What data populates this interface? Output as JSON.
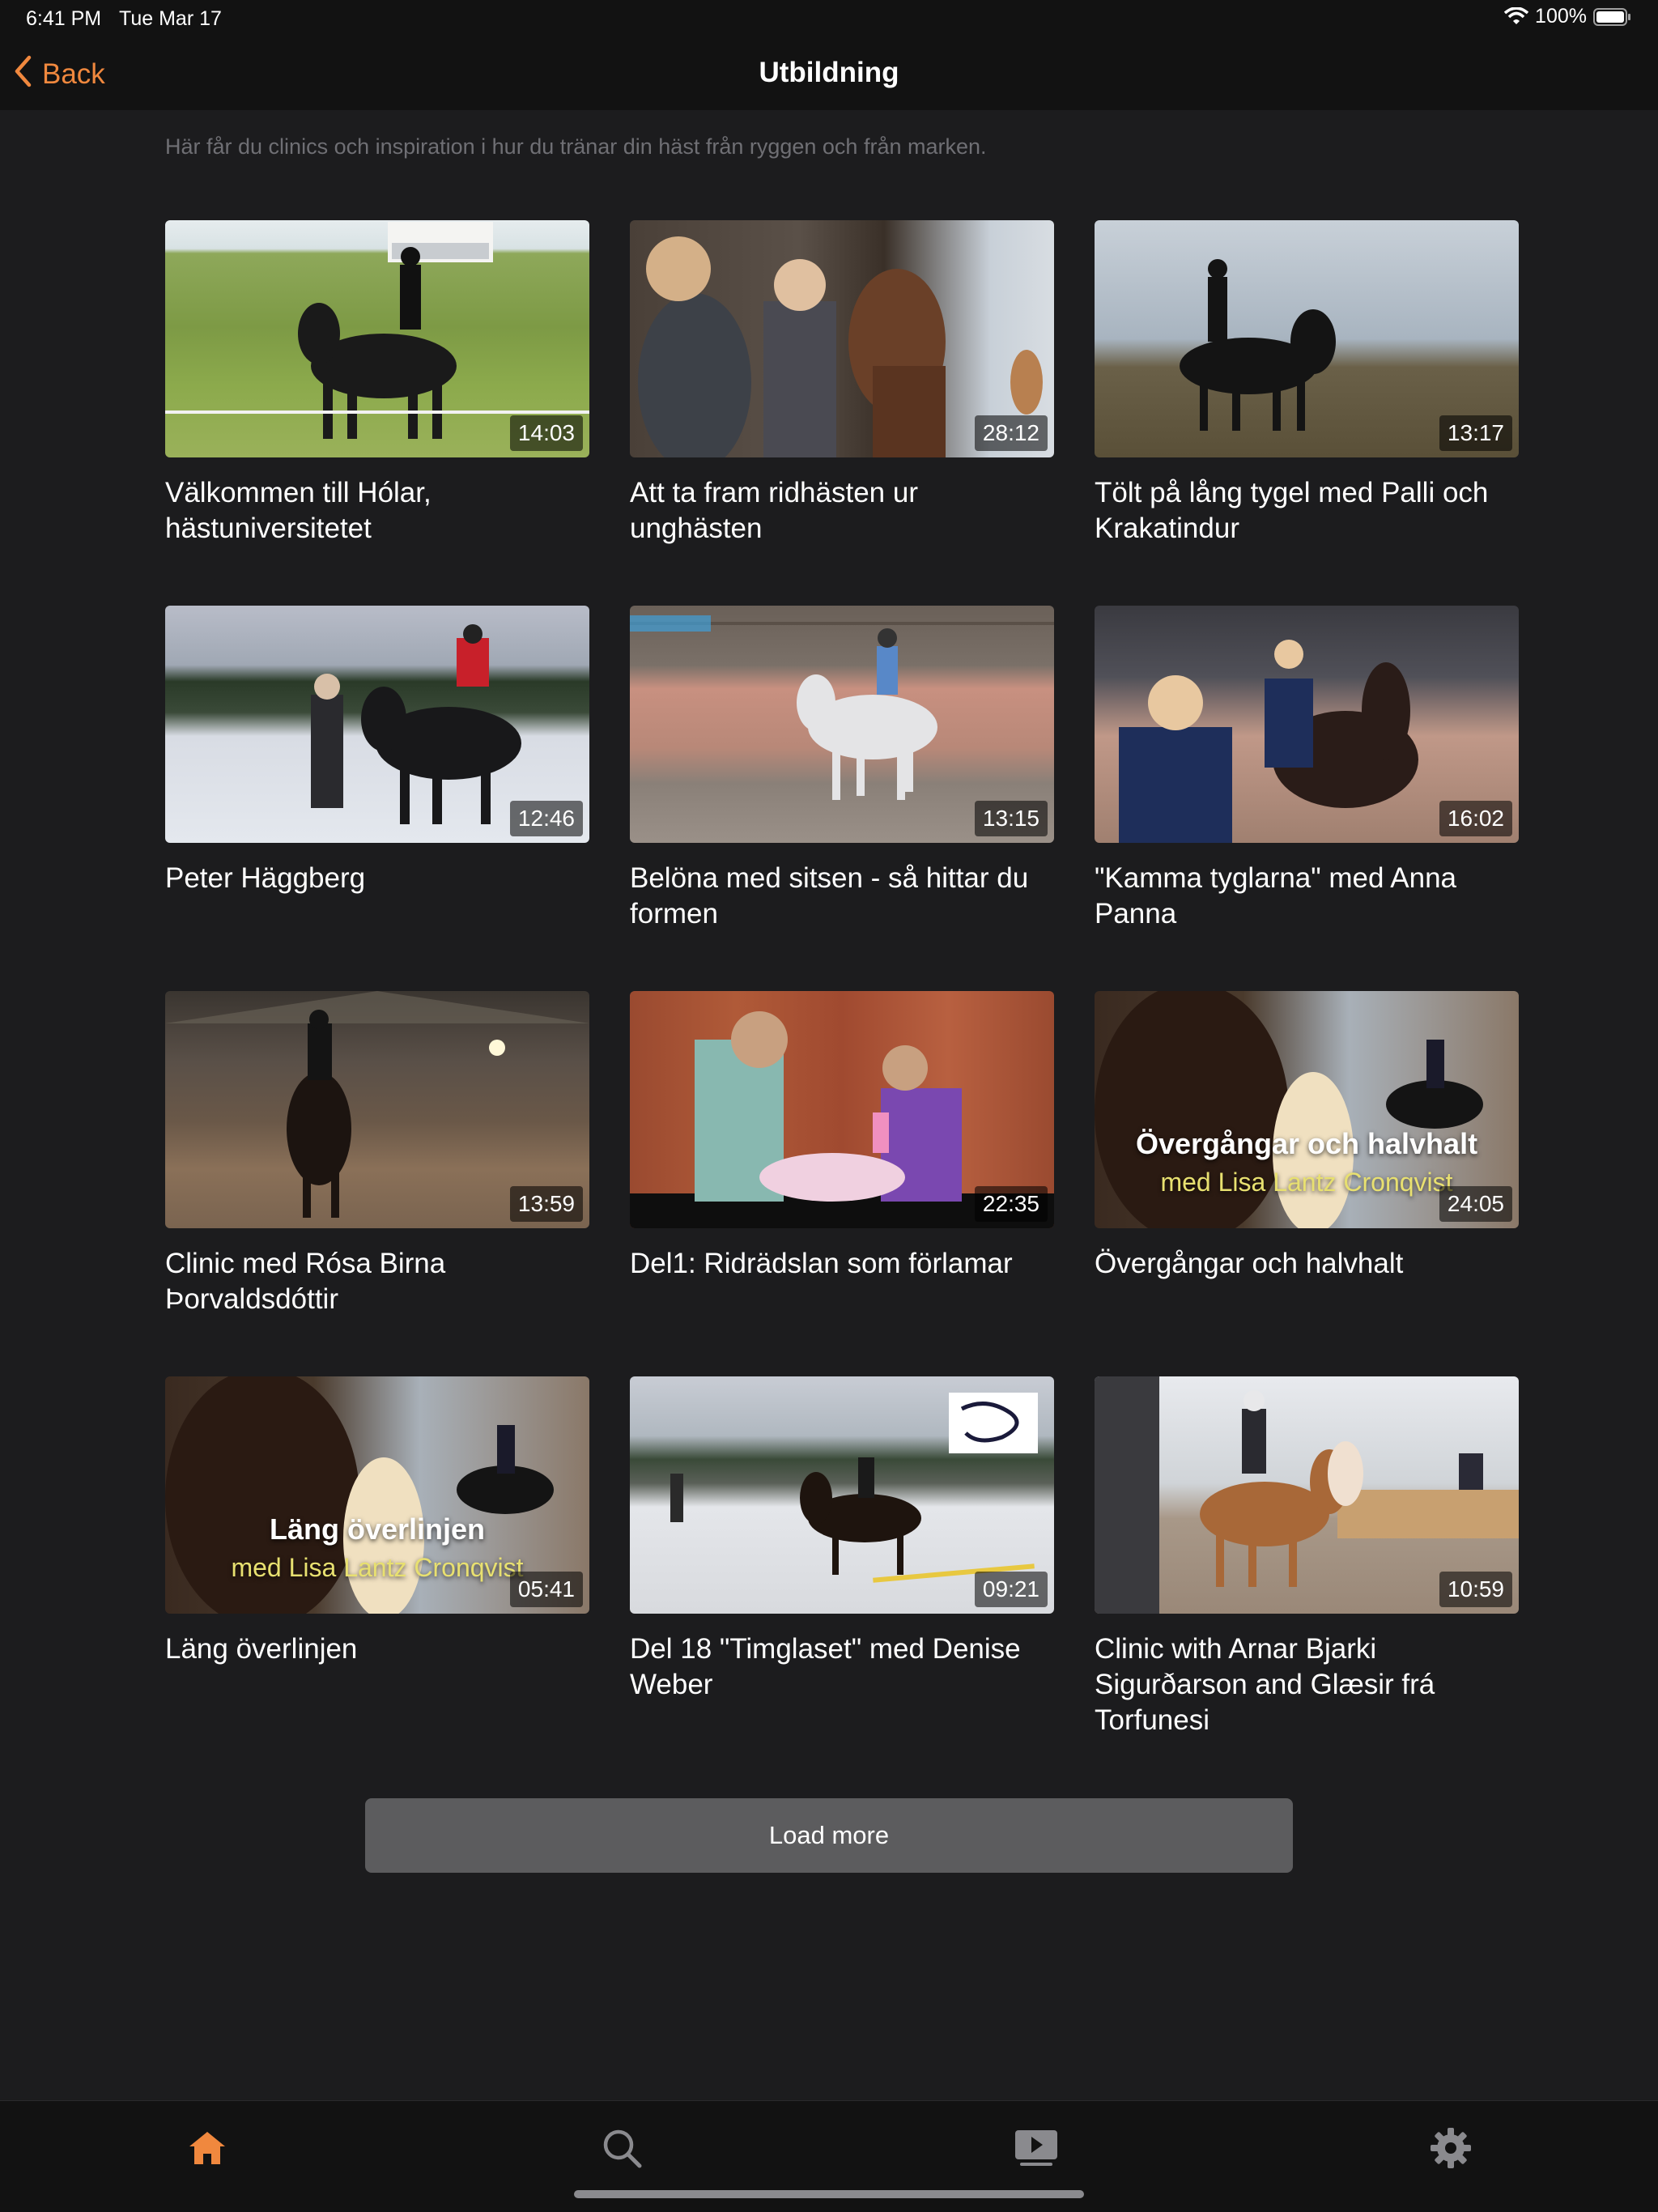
{
  "status": {
    "time": "6:41 PM",
    "date": "Tue Mar 17",
    "battery": "100%"
  },
  "nav": {
    "back_label": "Back",
    "title": "Utbildning"
  },
  "description": "Här får du clinics och inspiration i hur du tränar din häst från ryggen och från marken.",
  "videos": [
    {
      "title": "Välkommen till Hólar, hästuniversitetet",
      "duration": "14:03"
    },
    {
      "title": "Att ta fram ridhästen ur unghästen",
      "duration": "28:12"
    },
    {
      "title": "Tölt på lång tygel med Palli och Krakatindur",
      "duration": "13:17"
    },
    {
      "title": "Peter Häggberg",
      "duration": "12:46"
    },
    {
      "title": "Belöna med sitsen - så hittar du formen",
      "duration": "13:15"
    },
    {
      "title": "\"Kamma tyglarna\" med Anna Panna",
      "duration": "16:02"
    },
    {
      "title": "Clinic med Rósa Birna Þorvaldsdóttir",
      "duration": "13:59"
    },
    {
      "title": "Del1: Ridrädslan som förlamar",
      "duration": "22:35"
    },
    {
      "title": "Övergångar och halvhalt",
      "duration": "24:05",
      "overlay": "Övergångar och halvhalt",
      "overlay_sub": "med Lisa Lantz Cronqvist"
    },
    {
      "title": "Läng överlinjen",
      "duration": "05:41",
      "overlay": "Läng överlinjen",
      "overlay_sub": "med Lisa Lantz Cronqvist"
    },
    {
      "title": "Del 18 \"Timglaset\" med Denise Weber",
      "duration": "09:21"
    },
    {
      "title": "Clinic with Arnar Bjarki Sigurðarson and Glæsir frá Torfunesi",
      "duration": "10:59"
    }
  ],
  "load_more_label": "Load more",
  "tabs": [
    {
      "icon": "home-icon",
      "active": true
    },
    {
      "icon": "search-icon",
      "active": false
    },
    {
      "icon": "video-library-icon",
      "active": false
    },
    {
      "icon": "settings-icon",
      "active": false
    }
  ],
  "colors": {
    "accent": "#f0883e",
    "background": "#1c1c1e",
    "bar": "#121212",
    "inactive_icon": "#8a8a8e"
  }
}
